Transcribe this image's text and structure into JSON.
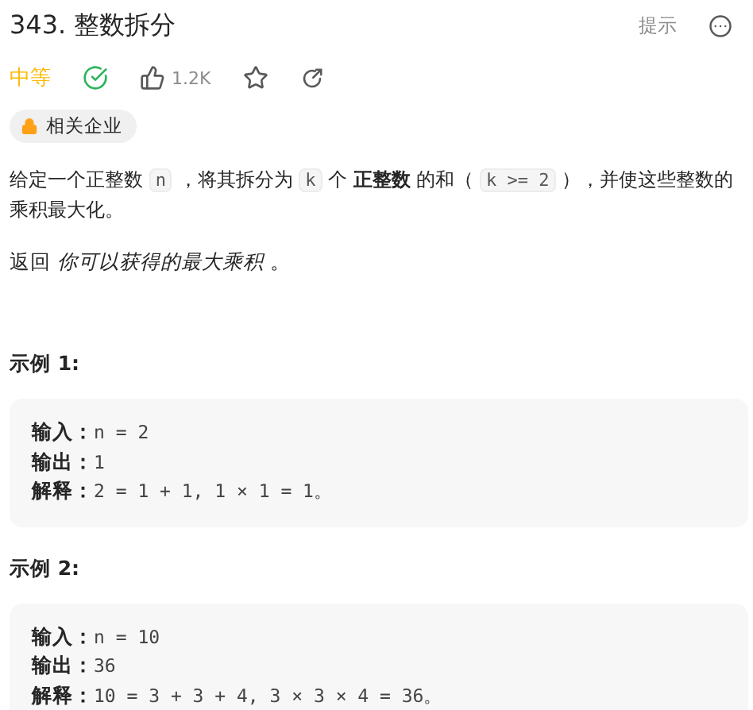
{
  "title": "343. 整数拆分",
  "hint_button": "提示",
  "meta": {
    "difficulty": "中等",
    "solved": true,
    "likes": "1.2K"
  },
  "tag": "相关企业",
  "description": [
    {
      "kind": "text",
      "text": "给定一个正整数 "
    },
    {
      "kind": "code",
      "text": "n"
    },
    {
      "kind": "text",
      "text": " ，将其拆分为 "
    },
    {
      "kind": "code",
      "text": "k"
    },
    {
      "kind": "text",
      "text": " 个 "
    },
    {
      "kind": "bold",
      "text": "正整数"
    },
    {
      "kind": "text",
      "text": " 的和（ "
    },
    {
      "kind": "code",
      "text": "k >= 2"
    },
    {
      "kind": "text",
      "text": " ），并使这些整数的乘积最大化。"
    }
  ],
  "return_text": "返回 *你可以获得的最大乘积* 。",
  "examples": [
    {
      "heading": "示例 1:",
      "lines": [
        {
          "label": "输入：",
          "value": "n = 2"
        },
        {
          "label": "输出：",
          "value": "1"
        },
        {
          "label": "解释：",
          "value": "2 = 1 + 1, 1 × 1 = 1。"
        }
      ]
    },
    {
      "heading": "示例 2:",
      "lines": [
        {
          "label": "输入：",
          "value": "n = 10"
        },
        {
          "label": "输出：",
          "value": "36"
        },
        {
          "label": "解释：",
          "value": "10 = 3 + 3 + 4, 3 × 3 × 4 = 36。"
        }
      ]
    }
  ]
}
